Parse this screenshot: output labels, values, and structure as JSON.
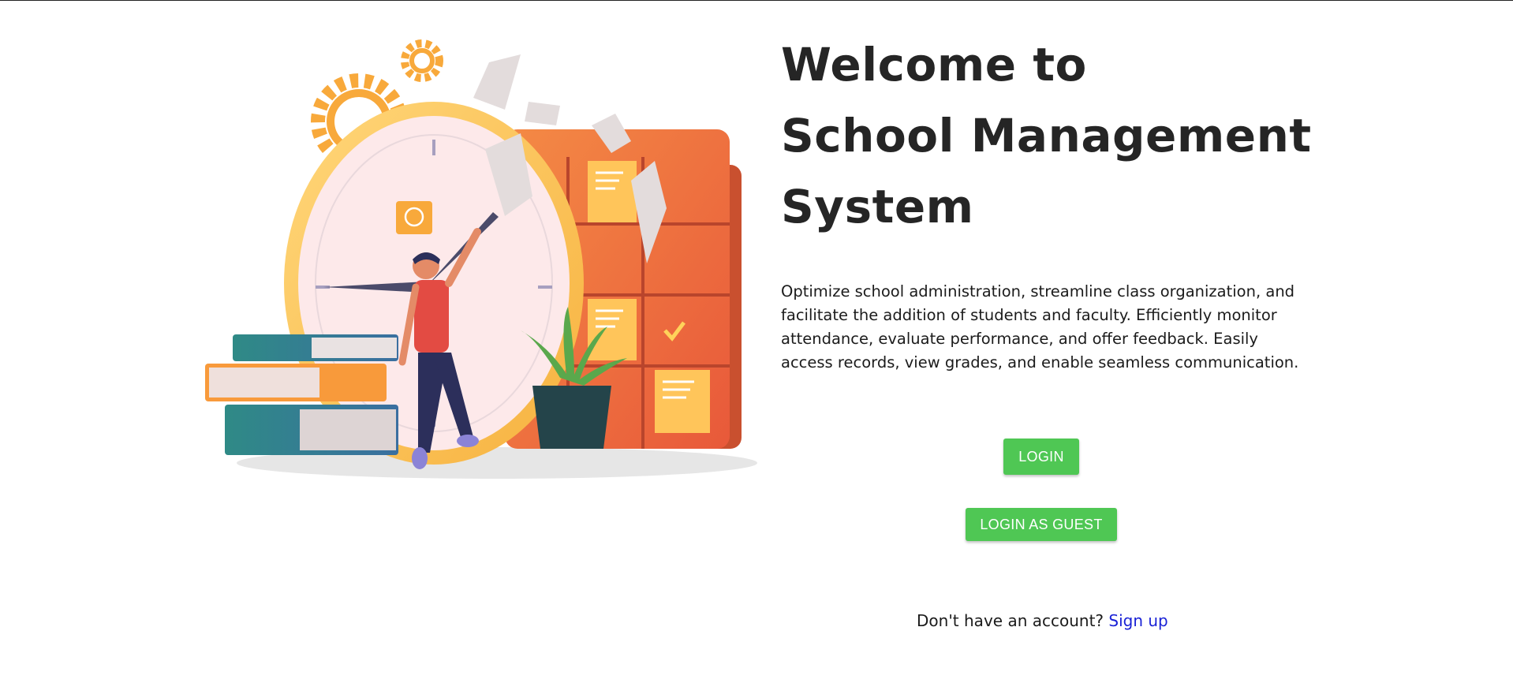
{
  "hero": {
    "title_line1": "Welcome to",
    "title_line2": "School Management",
    "title_line3": "System",
    "description": "Optimize school administration, streamline class organization, and facilitate the addition of students and faculty. Efficiently monitor attendance, evaluate performance, and offer feedback. Easily access records, view grades, and enable seamless communication."
  },
  "actions": {
    "login_label": "LOGIN",
    "guest_label": "LOGIN AS GUEST"
  },
  "signup": {
    "prompt": "Don't have an account?",
    "link_label": "Sign up"
  },
  "colors": {
    "button_green": "#4fc754",
    "link_blue": "#1a22d6",
    "title_text": "#252525"
  },
  "illustration": {
    "icon": "school-time-illustration"
  }
}
